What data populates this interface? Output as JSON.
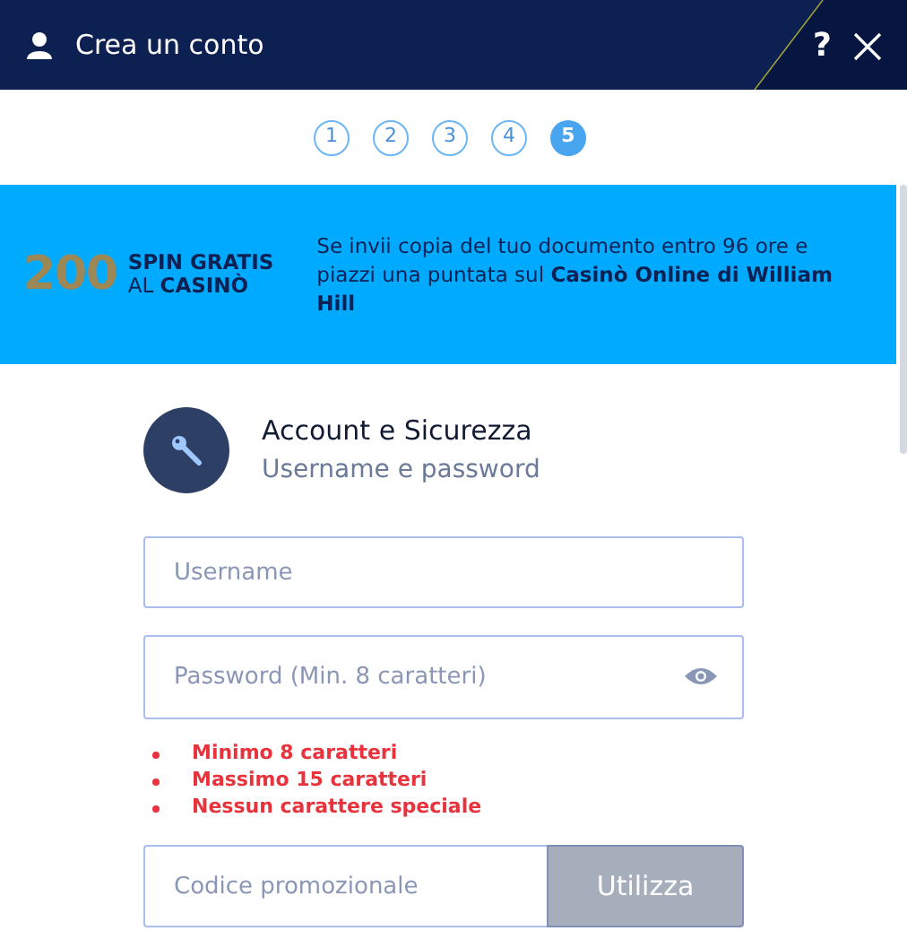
{
  "window": {
    "title": "Crea un conto"
  },
  "header_buttons": [
    "?"
  ],
  "steps": [
    {
      "label": "1",
      "selected": false
    },
    {
      "label": "2",
      "selected": false
    },
    {
      "label": "3",
      "selected": false
    },
    {
      "label": "4",
      "selected": false
    },
    {
      "label": "5",
      "selected": true
    }
  ],
  "banner": {
    "amount": "200",
    "line_1": "SPIN GRATIS",
    "line_2": "AL **CASINÒ**",
    "text": "Se invii copia del tuo documento entro 96 ore e piazzi una puntata sul **Casinò Online di William Hill**"
  },
  "section": {
    "title": "Account e Sicurezza",
    "subtitle": "Username e password"
  },
  "username": {
    "placeholder": "Username"
  },
  "password": {
    "placeholder": "Password (Min. 8 caratteri)"
  },
  "rules": [
    "Minimo 8 caratteri",
    "Massimo 15 caratteri",
    "Nessun carattere speciale"
  ],
  "promo": {
    "placeholder": "Codice promozionale",
    "button": "Utilizza",
    "button_disabled": true
  }
}
